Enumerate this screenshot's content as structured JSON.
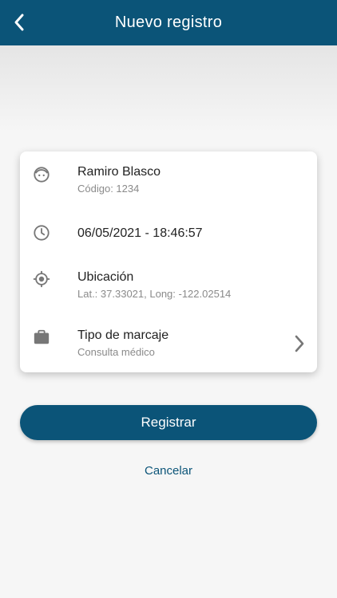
{
  "header": {
    "title": "Nuevo registro",
    "back_icon": "chevron-left-icon"
  },
  "card": {
    "employee": {
      "icon": "face-icon",
      "name": "Ramiro Blasco",
      "code": "Código: 1234"
    },
    "datetime": {
      "icon": "clock-icon",
      "value": "06/05/2021 - 18:46:57"
    },
    "location": {
      "icon": "gps-target-icon",
      "label": "Ubicación",
      "coords": "Lat.: 37.33021, Long: -122.02514"
    },
    "type": {
      "icon": "briefcase-icon",
      "label": "Tipo de marcaje",
      "value": "Consulta médico",
      "chevron_icon": "chevron-right-icon"
    }
  },
  "actions": {
    "register_label": "Registrar",
    "cancel_label": "Cancelar"
  },
  "colors": {
    "primary": "#0b5478",
    "icon_gray": "#777777",
    "secondary_text": "#8a8a8a"
  }
}
